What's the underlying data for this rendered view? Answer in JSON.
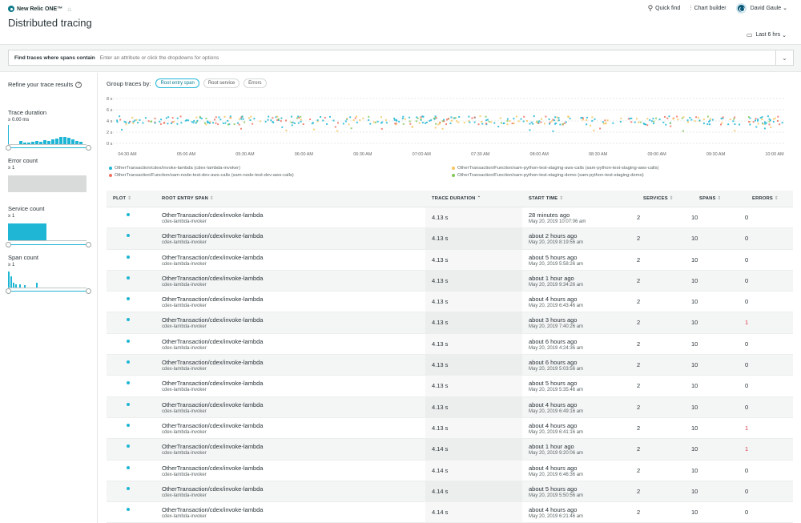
{
  "header": {
    "brand": "New Relic ONE™",
    "page_title": "Distributed tracing",
    "quick_find": "Quick find",
    "chart_builder": "Chart builder",
    "user_name": "David Gaule",
    "time_range": "Last 6 hrs"
  },
  "search": {
    "label": "Find traces where spans contain",
    "placeholder": "Enter an attribute or click the dropdowns for options"
  },
  "sidebar": {
    "title": "Refine your trace results",
    "filters": [
      {
        "name": "Trace duration",
        "sub": "≥ 0.00 ms"
      },
      {
        "name": "Error count",
        "sub": "≥ 1"
      },
      {
        "name": "Service count",
        "sub": "≥ 1"
      },
      {
        "name": "Span count",
        "sub": "≥ 1"
      }
    ]
  },
  "group_by": {
    "label": "Group traces by:",
    "options": [
      "Root entry span",
      "Root service",
      "Errors"
    ],
    "selected": "Root entry span"
  },
  "chart_data": {
    "type": "scatter",
    "y_ticks": [
      "8 s",
      "6 s",
      "4 s",
      "2 s",
      "0 s"
    ],
    "x_ticks": [
      "04:30 AM",
      "05:00 AM",
      "05:30 AM",
      "06:00 AM",
      "06:30 AM",
      "07:00 AM",
      "07:30 AM",
      "08:00 AM",
      "08:30 AM",
      "09:00 AM",
      "09:30 AM",
      "10:00 AM"
    ],
    "ylim": [
      0,
      8
    ],
    "series": [
      {
        "name": "OtherTransaction/cdex/invoke-lambda (cdex-lambda-invoker)",
        "color": "#1fb6d5"
      },
      {
        "name": "OtherTransaction/Function/sam-node-test-dev-aws-calls (sam-node-test-dev-aws-calls)",
        "color": "#f0715f"
      },
      {
        "name": "OtherTransaction/Function/sam-python-test-staging-aws-calls (sam-python-test-staging-aws-calls)",
        "color": "#f5c55c"
      },
      {
        "name": "OtherTransaction/Function/sam-python-test-staging-demo (sam-python-test-staging-demo)",
        "color": "#83c75a"
      }
    ]
  },
  "table": {
    "columns": [
      "PLOT",
      "ROOT ENTRY SPAN",
      "TRACE DURATION",
      "START TIME",
      "SERVICES",
      "SPANS",
      "ERRORS"
    ],
    "rows": [
      {
        "span": "OtherTransaction/cdex/invoke-lambda",
        "service": "cdex-lambda-invoker",
        "duration": "4.13 s",
        "ago": "28 minutes ago",
        "time": "May 20, 2019 10:07:06 am",
        "services": "2",
        "spans": "10",
        "errors": "0"
      },
      {
        "span": "OtherTransaction/cdex/invoke-lambda",
        "service": "cdex-lambda-invoker",
        "duration": "4.13 s",
        "ago": "about 2 hours ago",
        "time": "May 20, 2019 8:19:56 am",
        "services": "2",
        "spans": "10",
        "errors": "0"
      },
      {
        "span": "OtherTransaction/cdex/invoke-lambda",
        "service": "cdex-lambda-invoker",
        "duration": "4.13 s",
        "ago": "about 5 hours ago",
        "time": "May 20, 2019 5:58:26 am",
        "services": "2",
        "spans": "10",
        "errors": "0"
      },
      {
        "span": "OtherTransaction/cdex/invoke-lambda",
        "service": "cdex-lambda-invoker",
        "duration": "4.13 s",
        "ago": "about 1 hour ago",
        "time": "May 20, 2019 9:34:26 am",
        "services": "2",
        "spans": "10",
        "errors": "0"
      },
      {
        "span": "OtherTransaction/cdex/invoke-lambda",
        "service": "cdex-lambda-invoker",
        "duration": "4.13 s",
        "ago": "about 4 hours ago",
        "time": "May 20, 2019 6:43:46 am",
        "services": "2",
        "spans": "10",
        "errors": "0"
      },
      {
        "span": "OtherTransaction/cdex/invoke-lambda",
        "service": "cdex-lambda-invoker",
        "duration": "4.13 s",
        "ago": "about 3 hours ago",
        "time": "May 20, 2019 7:40:26 am",
        "services": "2",
        "spans": "10",
        "errors": "1"
      },
      {
        "span": "OtherTransaction/cdex/invoke-lambda",
        "service": "cdex-lambda-invoker",
        "duration": "4.13 s",
        "ago": "about 6 hours ago",
        "time": "May 20, 2019 4:24:36 am",
        "services": "2",
        "spans": "10",
        "errors": "0"
      },
      {
        "span": "OtherTransaction/cdex/invoke-lambda",
        "service": "cdex-lambda-invoker",
        "duration": "4.13 s",
        "ago": "about 6 hours ago",
        "time": "May 20, 2019 5:03:56 am",
        "services": "2",
        "spans": "10",
        "errors": "0"
      },
      {
        "span": "OtherTransaction/cdex/invoke-lambda",
        "service": "cdex-lambda-invoker",
        "duration": "4.13 s",
        "ago": "about 5 hours ago",
        "time": "May 20, 2019 5:35:46 am",
        "services": "2",
        "spans": "10",
        "errors": "0"
      },
      {
        "span": "OtherTransaction/cdex/invoke-lambda",
        "service": "cdex-lambda-invoker",
        "duration": "4.13 s",
        "ago": "about 4 hours ago",
        "time": "May 20, 2019 6:49:16 am",
        "services": "2",
        "spans": "10",
        "errors": "0"
      },
      {
        "span": "OtherTransaction/cdex/invoke-lambda",
        "service": "cdex-lambda-invoker",
        "duration": "4.13 s",
        "ago": "about 4 hours ago",
        "time": "May 20, 2019 6:41:16 am",
        "services": "2",
        "spans": "10",
        "errors": "1"
      },
      {
        "span": "OtherTransaction/cdex/invoke-lambda",
        "service": "cdex-lambda-invoker",
        "duration": "4.14 s",
        "ago": "about 1 hour ago",
        "time": "May 20, 2019 9:20:06 am",
        "services": "2",
        "spans": "10",
        "errors": "1"
      },
      {
        "span": "OtherTransaction/cdex/invoke-lambda",
        "service": "cdex-lambda-invoker",
        "duration": "4.14 s",
        "ago": "about 4 hours ago",
        "time": "May 20, 2019 6:46:36 am",
        "services": "2",
        "spans": "10",
        "errors": "0"
      },
      {
        "span": "OtherTransaction/cdex/invoke-lambda",
        "service": "cdex-lambda-invoker",
        "duration": "4.14 s",
        "ago": "about 5 hours ago",
        "time": "May 20, 2019 5:50:56 am",
        "services": "2",
        "spans": "10",
        "errors": "0"
      },
      {
        "span": "OtherTransaction/cdex/invoke-lambda",
        "service": "cdex-lambda-invoker",
        "duration": "4.14 s",
        "ago": "about 4 hours ago",
        "time": "May 20, 2019 6:21:46 am",
        "services": "2",
        "spans": "10",
        "errors": "0"
      }
    ]
  }
}
